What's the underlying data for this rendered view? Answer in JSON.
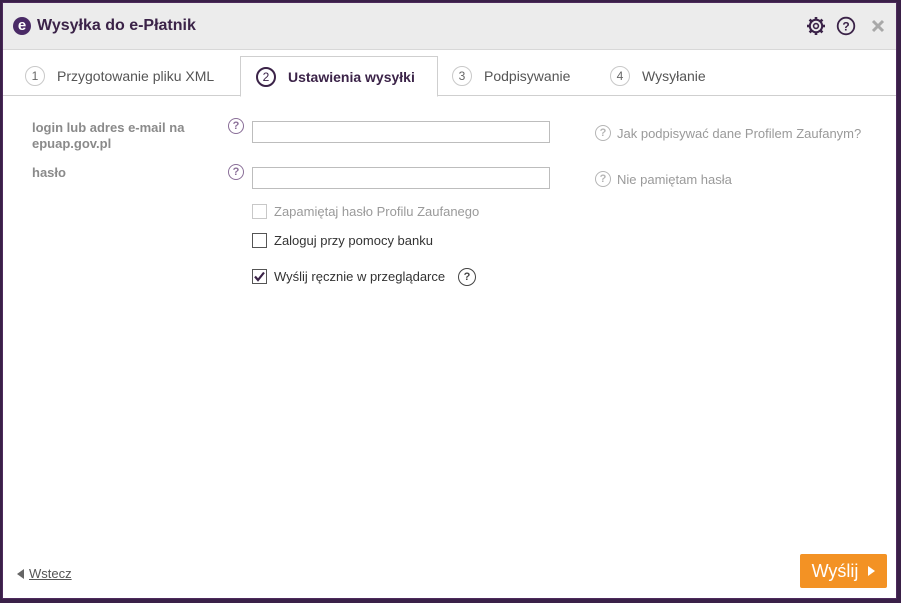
{
  "window": {
    "title": "Wysyłka do e-Płatnik",
    "logo_letter": "e",
    "icons": [
      "gear-icon",
      "help-icon",
      "close-icon"
    ]
  },
  "tabs": [
    {
      "number": "1",
      "label": "Przygotowanie pliku XML",
      "active": false
    },
    {
      "number": "2",
      "label": "Ustawienia wysyłki",
      "active": true
    },
    {
      "number": "3",
      "label": "Podpisywanie",
      "active": false
    },
    {
      "number": "4",
      "label": "Wysyłanie",
      "active": false
    }
  ],
  "form": {
    "login_label_line1": "login lub adres e-mail na",
    "login_label_line2": "epuap.gov.pl",
    "login_value": "",
    "password_label": "hasło",
    "password_value": "",
    "help_glyph": "?",
    "profile_help_link": "Jak podpisywać dane Profilem Zaufanym?",
    "forgot_password_link": "Nie pamiętam hasła",
    "checkboxes": [
      {
        "label": "Zapamiętaj hasło Profilu Zaufanego",
        "checked": false,
        "disabled": true
      },
      {
        "label": "Zaloguj przy pomocy banku",
        "checked": false,
        "disabled": false
      },
      {
        "label": "Wyślij ręcznie w przeglądarce",
        "checked": true,
        "disabled": false
      }
    ]
  },
  "footer": {
    "back_label": "Wstecz",
    "send_label": "Wyślij"
  },
  "colors": {
    "accent": "#3b2348",
    "send_button": "#f39224",
    "help_icon": "#8a6f98"
  }
}
